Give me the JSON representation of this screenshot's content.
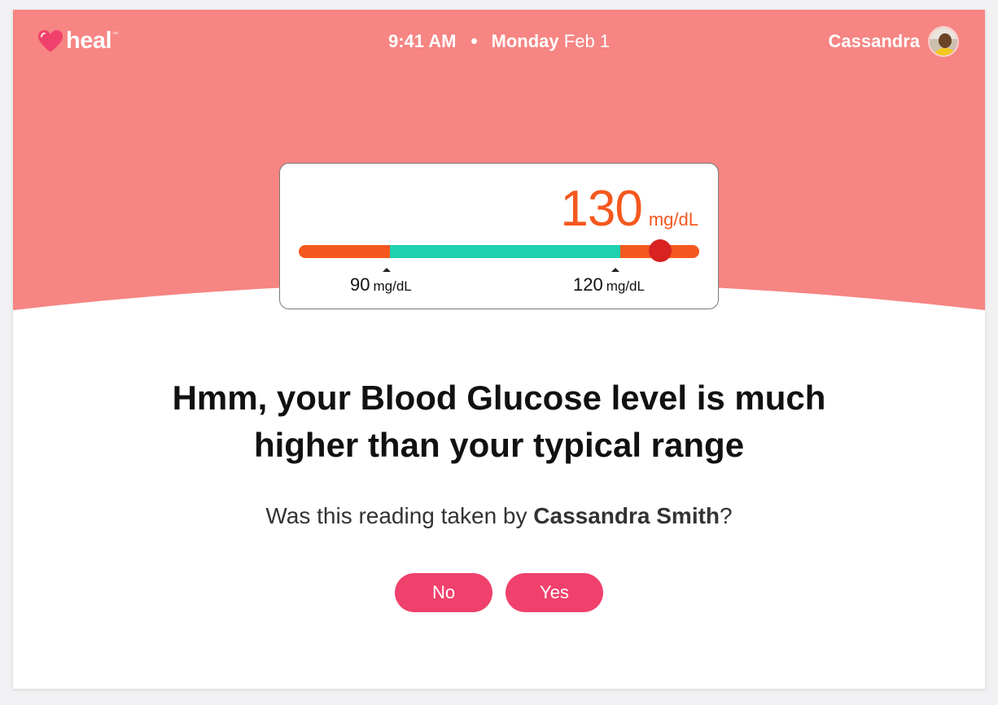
{
  "colors": {
    "header_bg": "#f68583",
    "accent_orange": "#f4581e",
    "in_range_teal": "#1fd1b0",
    "marker_red": "#d92222",
    "button_pink": "#f0416d"
  },
  "header": {
    "logo_text": "heal",
    "logo_tm": "™",
    "time": "9:41 AM",
    "day": "Monday",
    "date": "Feb 1",
    "user_name": "Cassandra"
  },
  "reading": {
    "value": "130",
    "unit": "mg/dL",
    "range_low_value": "90",
    "range_low_unit": "mg/dL",
    "range_high_value": "120",
    "range_high_unit": "mg/dL"
  },
  "message": {
    "headline_line1": "Hmm, your Blood Glucose level is much",
    "headline_line2": "higher than your typical range",
    "question_prefix": "Was this reading taken by ",
    "question_name": "Cassandra Smith",
    "question_suffix": "?"
  },
  "buttons": {
    "no_label": "No",
    "yes_label": "Yes"
  }
}
